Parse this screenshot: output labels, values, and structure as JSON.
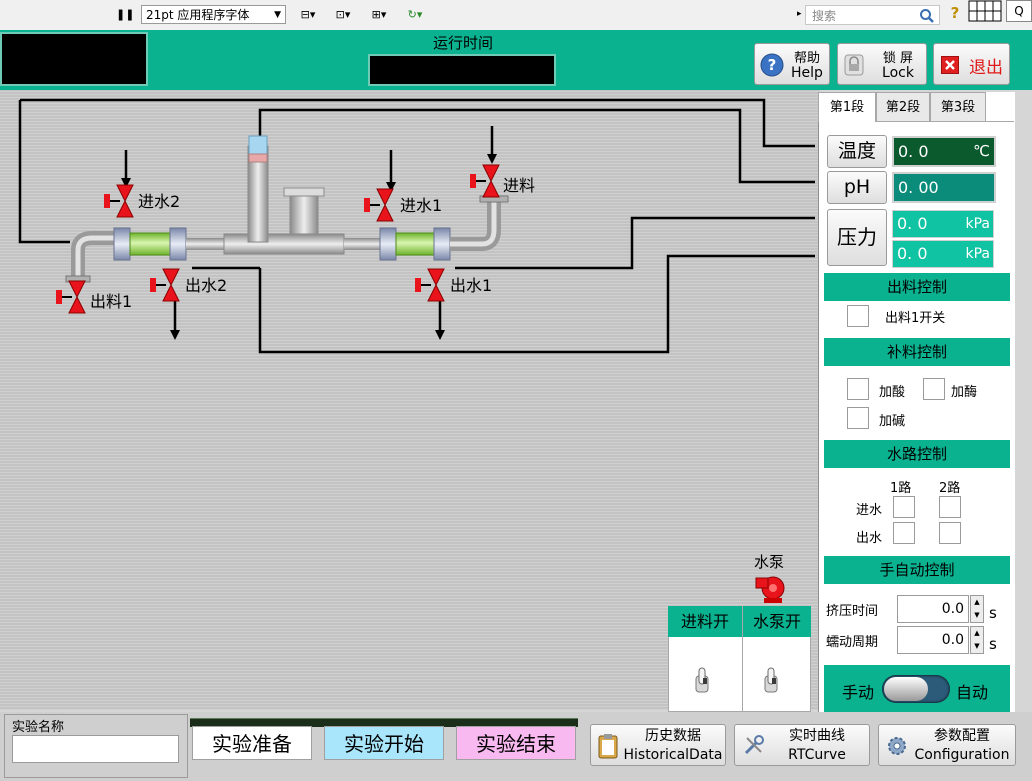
{
  "toolbar": {
    "pause_glyph": "❚❚",
    "font_select": "21pt 应用程序字体",
    "align_glyph": "⊟▾",
    "distribute_glyph": "⊡▾",
    "resize_glyph": "⊞▾",
    "reorder_glyph": "↻▾",
    "search_placeholder": "搜索",
    "help_glyph": "?"
  },
  "header": {
    "runtime_label": "运行时间",
    "help_button": {
      "title": "帮助",
      "sub": "Help"
    },
    "lock_button": {
      "title": "锁 屏",
      "sub": "Lock"
    },
    "exit_button": {
      "title": "退出"
    }
  },
  "process": {
    "valves": {
      "water_in_2": "进水2",
      "water_in_1": "进水1",
      "feed_in": "进料",
      "discharge_1": "出料1",
      "water_out_2": "出水2",
      "water_out_1": "出水1"
    },
    "pump_label": "水泵",
    "switches": {
      "feed_on": "进料开",
      "pump_on": "水泵开"
    }
  },
  "panel": {
    "tabs": [
      "第1段",
      "第2段",
      "第3段"
    ],
    "temperature": {
      "label": "温度",
      "value": "0. 0",
      "unit": "℃"
    },
    "ph": {
      "label": "pH",
      "value": "0. 00"
    },
    "pressure": {
      "label": "压力",
      "value1": "0. 0",
      "unit1": "kPa",
      "value2": "0. 0",
      "unit2": "kPa"
    },
    "discharge_control": {
      "title": "出料控制",
      "switch1": "出料1开关"
    },
    "feed_control": {
      "title": "补料控制",
      "acid": "加酸",
      "enzyme": "加酶",
      "base": "加碱"
    },
    "water_control": {
      "title": "水路控制",
      "col1": "1路",
      "col2": "2路",
      "row_in": "进水",
      "row_out": "出水"
    },
    "auto_control": {
      "title": "手自动控制",
      "squeeze_time_label": "挤压时间",
      "squeeze_time": "0.0",
      "peristaltic_label": "蠕动周期",
      "peristaltic": "0.0",
      "unit": "s",
      "manual": "手动",
      "auto": "自动"
    }
  },
  "bottom": {
    "experiment_name_label": "实验名称",
    "experiment_name_value": "",
    "prepare": "实验准备",
    "start": "实验开始",
    "end": "实验结束",
    "history": {
      "title": "历史数据",
      "sub": "HistoricalData"
    },
    "rtcurve": {
      "title": "实时曲线",
      "sub": "RTCurve"
    },
    "config": {
      "title": "参数配置",
      "sub": "Configuration"
    }
  },
  "colors": {
    "header_green": "#0bb28f",
    "valve_red": "#e8131b",
    "display_dark_green": "#0b5a2d",
    "display_teal": "#0b8c7a",
    "prepare_bg": "#ffffff",
    "start_bg": "#a9e6fb",
    "end_bg": "#f8b8f0"
  }
}
